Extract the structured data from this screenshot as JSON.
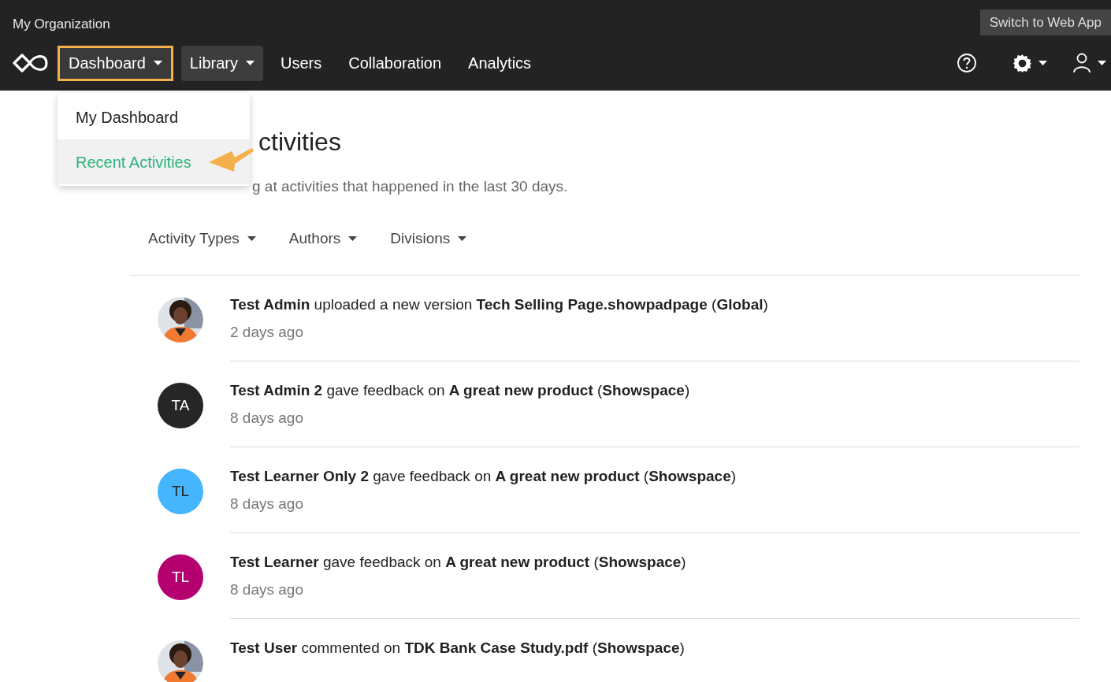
{
  "header": {
    "organization": "My Organization",
    "switch_button": "Switch to Web App"
  },
  "nav": [
    {
      "label": "Dashboard",
      "kind": "dropdown",
      "selected": true
    },
    {
      "label": "Library",
      "kind": "dropdown",
      "selected": false
    },
    {
      "label": "Users",
      "kind": "link",
      "selected": false
    },
    {
      "label": "Collaboration",
      "kind": "link",
      "selected": false
    },
    {
      "label": "Analytics",
      "kind": "link",
      "selected": false
    }
  ],
  "dropdown_menu": [
    {
      "label": "My Dashboard",
      "selected": false
    },
    {
      "label": "Recent Activities",
      "selected": true
    }
  ],
  "page": {
    "title": "ctivities",
    "subtitle": "g at activities that happened in the last 30 days."
  },
  "filters": [
    "Activity Types",
    "Authors",
    "Divisions"
  ],
  "activities": [
    {
      "text": "**Test Admin** uploaded a new version **Tech Selling Page.showpadpage** (**Global**)",
      "time": "2 days ago"
    },
    {
      "avatar": {
        "kind": "initials",
        "initials": "TA",
        "color": "#262626"
      },
      "text": "**Test Admin 2** gave feedback on **A great new product** (**Showspace**)",
      "time": "8 days ago"
    },
    {
      "avatar": {
        "kind": "initials",
        "initials": "TL",
        "color": "#45b6fe"
      },
      "text": "**Test Learner Only 2** gave feedback on **A great new product** (**Showspace**)",
      "time": "8 days ago"
    },
    {
      "avatar": {
        "kind": "initials",
        "initials": "TL",
        "color": "#b5006f"
      },
      "text": "**Test Learner** gave feedback on **A great new product** (**Showspace**)",
      "time": "8 days ago"
    },
    {
      "text": "**Test User** commented on **TDK Bank Case Study.pdf** (**Showspace**)"
    }
  ]
}
